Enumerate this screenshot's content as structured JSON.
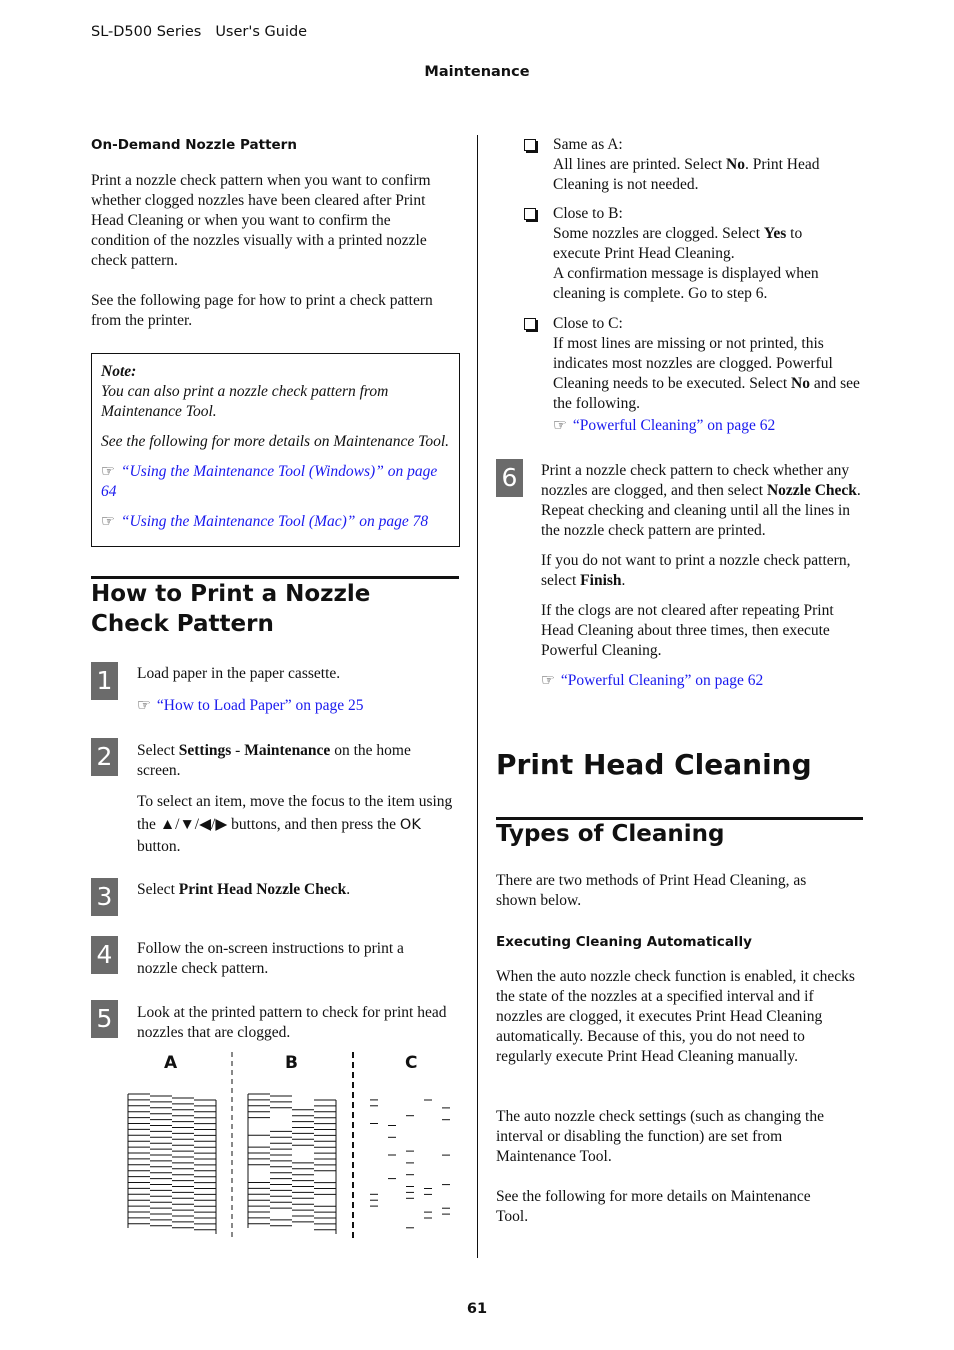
{
  "header": {
    "product": "SL-D500 Series",
    "guide": "User's Guide",
    "section": "Maintenance"
  },
  "left": {
    "on_demand": {
      "title": "On-Demand Nozzle Pattern",
      "para1": "Print a nozzle check pattern when you want to confirm whether clogged nozzles have been cleared after Print Head Cleaning or when you want to confirm the condition of the nozzles visually with a printed nozzle check pattern.",
      "para2": "See the following page for how to print a check pattern from the printer."
    },
    "note": {
      "label": "Note:",
      "text1": "You can also print a nozzle check pattern from Maintenance Tool.",
      "text2": "See the following for more details on Maintenance Tool.",
      "link1": "“Using the Maintenance Tool (Windows)” on page 64",
      "link2": "“Using the Maintenance Tool (Mac)” on page 78"
    },
    "howto_title": "How to Print a Nozzle Check Pattern",
    "steps": [
      {
        "num": "1",
        "pre": "Load paper in the paper cassette.",
        "link": "“How to Load Paper” on page 25"
      },
      {
        "num": "2",
        "pre": "Select ",
        "b1": "Settings",
        "mid": " - ",
        "b2": "Maintenance",
        "post": " on the home screen.",
        "para2a": "To select an item, move the focus to the item using the ",
        "arrows": "▲/▼/◀/▶",
        "para2b": " buttons, and then press the ",
        "ok": "OK",
        "para2c": " button."
      },
      {
        "num": "3",
        "pre": "Select ",
        "b1": "Print Head Nozzle Check",
        "post": "."
      },
      {
        "num": "4",
        "pre": "Follow the on-screen instructions to print a nozzle check pattern."
      },
      {
        "num": "5",
        "pre": "Look at the printed pattern to check for print head nozzles that are clogged."
      }
    ],
    "pattern_labels": [
      "A",
      "B",
      "C"
    ]
  },
  "right": {
    "options": [
      {
        "title": "Same as A:",
        "t1": "All lines are printed. Select ",
        "b1": "No",
        "t2": ". Print Head Cleaning is not needed."
      },
      {
        "title": "Close to B:",
        "t1": "Some nozzles are clogged. Select ",
        "b1": "Yes",
        "t2": " to execute Print Head Cleaning.",
        "t3": "A confirmation message is displayed when cleaning is complete. Go to step 6."
      },
      {
        "title": "Close to C:",
        "t1": "If most lines are missing or not printed, this indicates most nozzles are clogged. Powerful Cleaning needs to be executed. Select ",
        "b1": "No",
        "t2": " and see the following.",
        "link": "“Powerful Cleaning” on page 62"
      }
    ],
    "step6": {
      "num": "6",
      "t1": "Print a nozzle check pattern to check whether any nozzles are clogged, and then select ",
      "b1": "Nozzle Check",
      "t2": ". Repeat checking and cleaning until all the lines in the nozzle check pattern are printed.",
      "p2a": "If you do not want to print a nozzle check pattern, select ",
      "p2b": "Finish",
      "p2c": ".",
      "p3": "If the clogs are not cleared after repeating Print Head Cleaning about three times, then execute Powerful Cleaning.",
      "link": "“Powerful Cleaning” on page 62"
    },
    "phc_title": "Print Head Cleaning",
    "types_title": "Types of Cleaning",
    "types_para": "There are two methods of Print Head Cleaning, as shown below.",
    "auto_title": "Executing Cleaning Automatically",
    "auto_p1": "When the auto nozzle check function is enabled, it checks the state of the nozzles at a specified interval and if nozzles are clogged, it executes Print Head Cleaning automatically. Because of this, you do not need to regularly execute Print Head Cleaning manually.",
    "auto_p2": "The auto nozzle check settings (such as changing the interval or disabling the function) are set from Maintenance Tool.",
    "auto_p3": "See the following for more details on Maintenance Tool."
  },
  "footer": {
    "page_number": "61"
  },
  "colors": {
    "link": "#1a1aee",
    "step_box": "#6b6b6b"
  }
}
